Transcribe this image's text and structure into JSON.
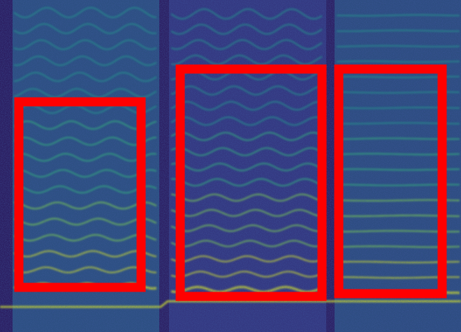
{
  "image": {
    "kind": "spectrogram",
    "colormap": [
      "#2d1b5e",
      "#3b3f8a",
      "#2f6c8e",
      "#22958a",
      "#33b479",
      "#7fd34e",
      "#d8e628"
    ],
    "background_color": "#2c2f74"
  },
  "highlight": {
    "color": "#ff0000",
    "boxes": [
      {
        "label": "left-region"
      },
      {
        "label": "center-region"
      },
      {
        "label": "right-region"
      }
    ]
  }
}
